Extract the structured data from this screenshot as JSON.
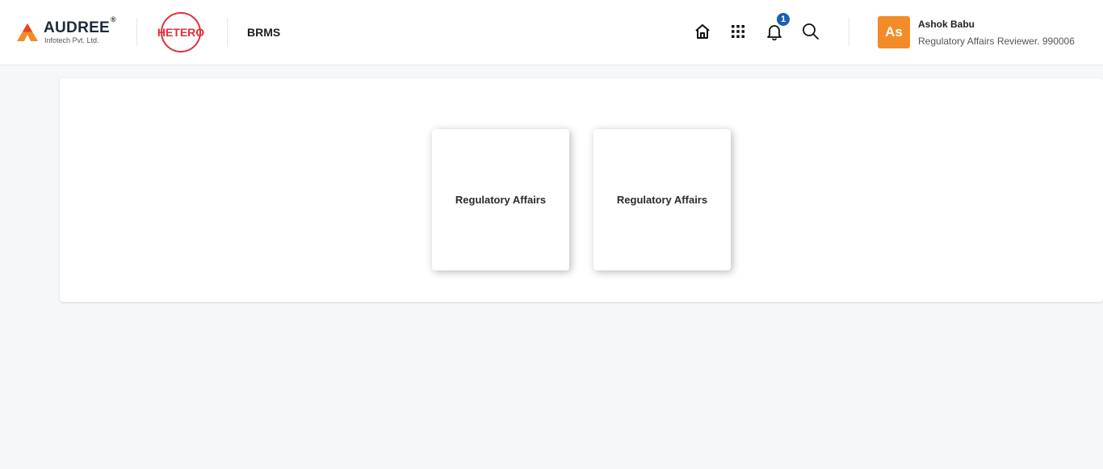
{
  "header": {
    "brand": {
      "name": "AUDREE",
      "registered": "®",
      "subtitle": "Infotech Pvt. Ltd."
    },
    "client_logo_text": "HETERO",
    "app_title": "BRMS",
    "icons": {
      "home": "home-icon",
      "apps": "apps-grid-icon",
      "notifications": "bell-icon",
      "search": "search-icon"
    },
    "notification_count": "1",
    "user": {
      "initials": "As",
      "name": "Ashok Babu",
      "role": "Regulatory Affairs Reviewer. 990006"
    }
  },
  "main": {
    "cards": [
      {
        "label": "Regulatory Affairs"
      },
      {
        "label": "Regulatory Affairs"
      }
    ]
  },
  "colors": {
    "accent_orange": "#f28c28",
    "badge_blue": "#1a5fb4",
    "hetero_red": "#e0303a",
    "background": "#f6f7f9"
  }
}
